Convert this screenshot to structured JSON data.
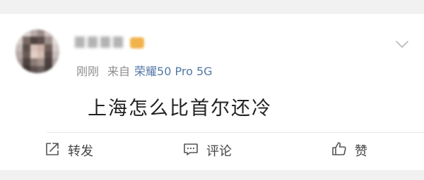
{
  "post": {
    "meta": {
      "time": "刚刚",
      "source_prefix": "来自",
      "device": "荣耀50 Pro 5G"
    },
    "content": "上海怎么比首尔还冷"
  },
  "actions": {
    "repost_label": "转发",
    "comment_label": "评论",
    "like_label": "赞"
  },
  "icons": {
    "options": "chevron-down-icon",
    "repost": "share-icon",
    "comment": "comment-icon",
    "like": "thumbs-up-icon"
  },
  "colors": {
    "device_link": "#5478a6",
    "muted_text": "#8d8d8d",
    "vip_badge": "#f2b24c"
  }
}
